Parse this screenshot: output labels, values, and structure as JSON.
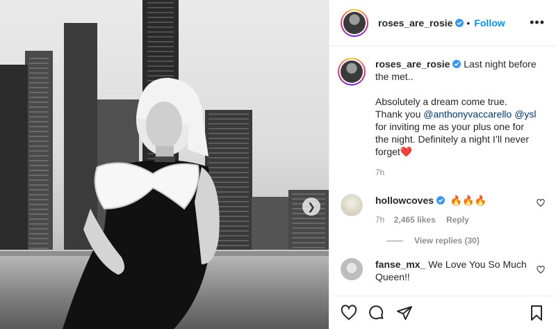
{
  "post": {
    "username": "roses_are_rosie",
    "follow_label": "Follow",
    "separator": "•",
    "more_label": "•••",
    "next_label": "❯"
  },
  "caption": {
    "username": "roses_are_rosie",
    "text_before": " Last night before the met..",
    "text_middle": "Absolutely a dream come true. Thank you ",
    "mention1": "@anthonyvaccarello",
    "space": " ",
    "mention2": "@ysl",
    "text_after": " for inviting me as your plus one for the night. Definitely a night I’ll never forget",
    "emoji": "❤️",
    "time": "7h"
  },
  "comments": [
    {
      "username": "hollowcoves",
      "text": "🔥🔥🔥",
      "time": "7h",
      "likes": "2,465 likes",
      "reply_label": "Reply",
      "view_replies": "View replies (30)"
    },
    {
      "username": "fanse_mx_",
      "text": " We Love You So Much Queen!!"
    }
  ],
  "colors": {
    "accent": "#0095f6",
    "verified": "#3897f0",
    "text": "#262626",
    "muted": "#8e8e8e"
  },
  "icons": [
    "verified-badge-icon",
    "heart-icon",
    "comment-icon",
    "share-icon",
    "bookmark-icon",
    "chevron-right-icon"
  ]
}
